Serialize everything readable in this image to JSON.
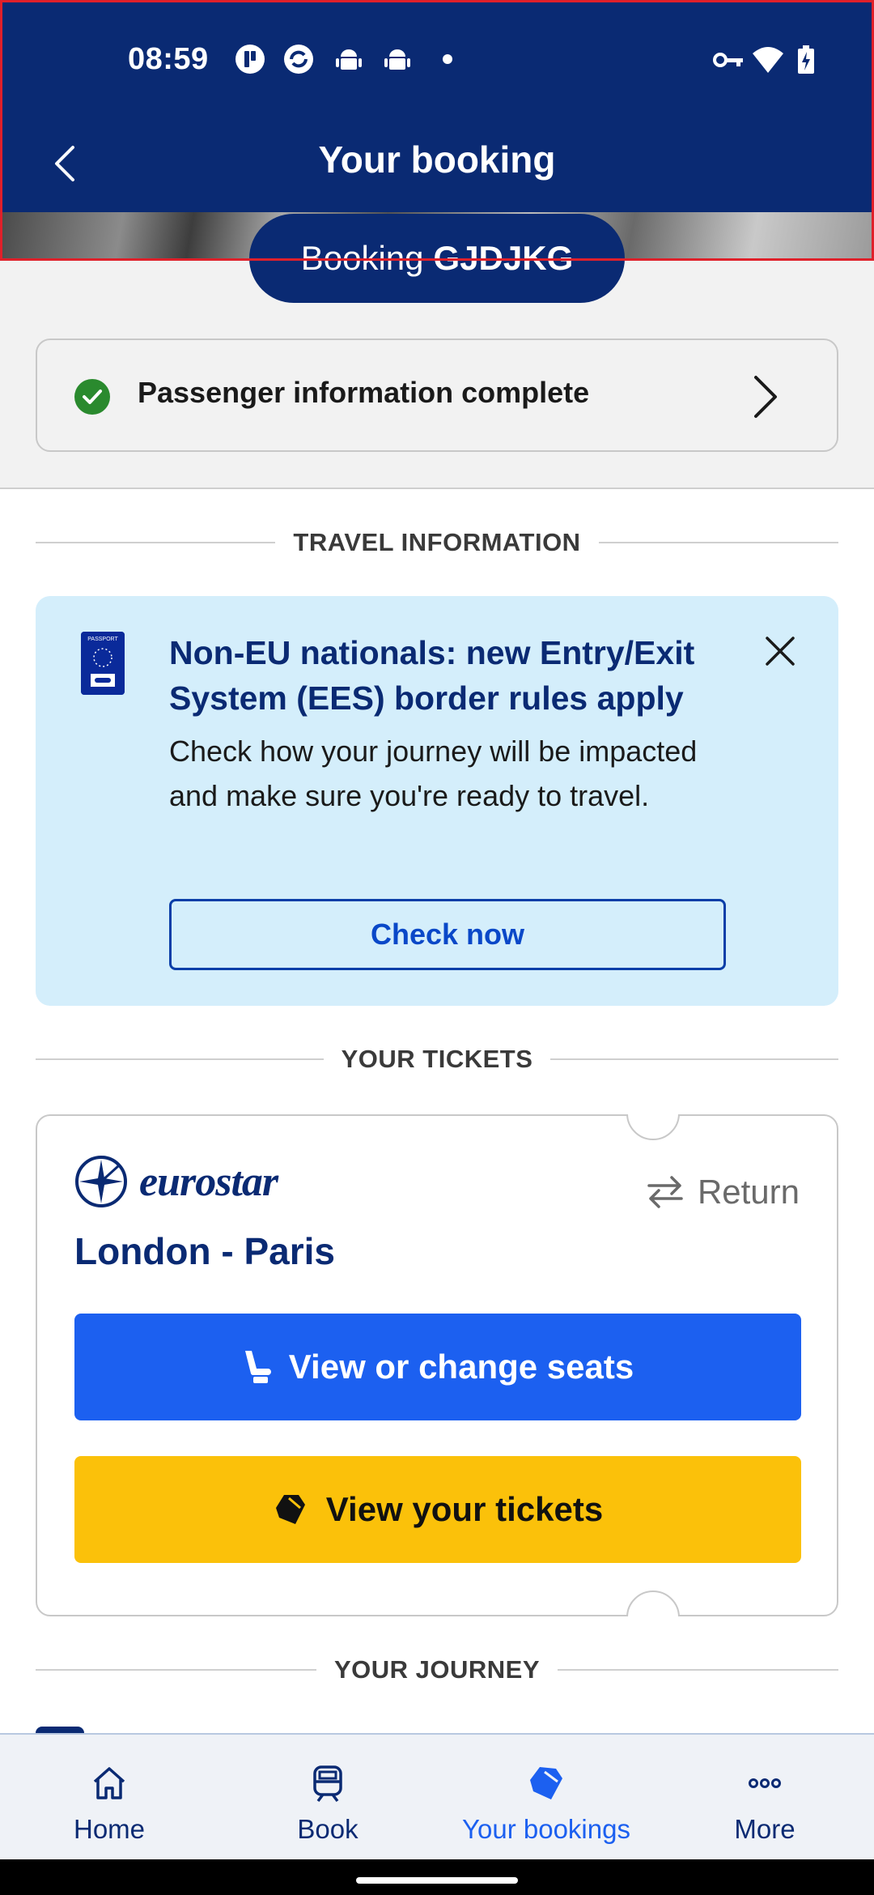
{
  "status_bar": {
    "time": "08:59",
    "left_icons": [
      "app-notification-icon",
      "sync-icon",
      "android-icon",
      "android-icon",
      "dot-icon"
    ],
    "right_icons": [
      "vpn-key-icon",
      "wifi-icon",
      "battery-charging-icon"
    ]
  },
  "header": {
    "title": "Your booking",
    "back_icon": "chevron-left-icon",
    "booking_prefix": "Booking",
    "booking_ref": "GJDJKG"
  },
  "passenger": {
    "status": "Passenger information complete"
  },
  "sections": {
    "travel_info": "TRAVEL INFORMATION",
    "tickets": "YOUR TICKETS",
    "journey": "YOUR JOURNEY"
  },
  "ees_banner": {
    "title": "Non-EU nationals: new Entry/Exit System (EES) border rules apply",
    "body": "Check how your journey will be impacted and make sure you're ready to travel.",
    "button": "Check now",
    "passport_label": "PASSPORT"
  },
  "ticket": {
    "brand": "eurostar",
    "trip_type": "Return",
    "route": "London - Paris",
    "seats_button": "View or change seats",
    "tickets_button": "View your tickets"
  },
  "nav": {
    "items": [
      {
        "label": "Home",
        "icon": "home-icon",
        "active": false
      },
      {
        "label": "Book",
        "icon": "train-icon",
        "active": false
      },
      {
        "label": "Your bookings",
        "icon": "tickets-icon",
        "active": true
      },
      {
        "label": "More",
        "icon": "more-dots-icon",
        "active": false
      }
    ]
  },
  "colors": {
    "brand_navy": "#0a2a73",
    "primary_blue": "#1c60f0",
    "ticket_yellow": "#fbc10a",
    "banner_bg": "#d4eefb",
    "success_green": "#2a8a2e"
  }
}
